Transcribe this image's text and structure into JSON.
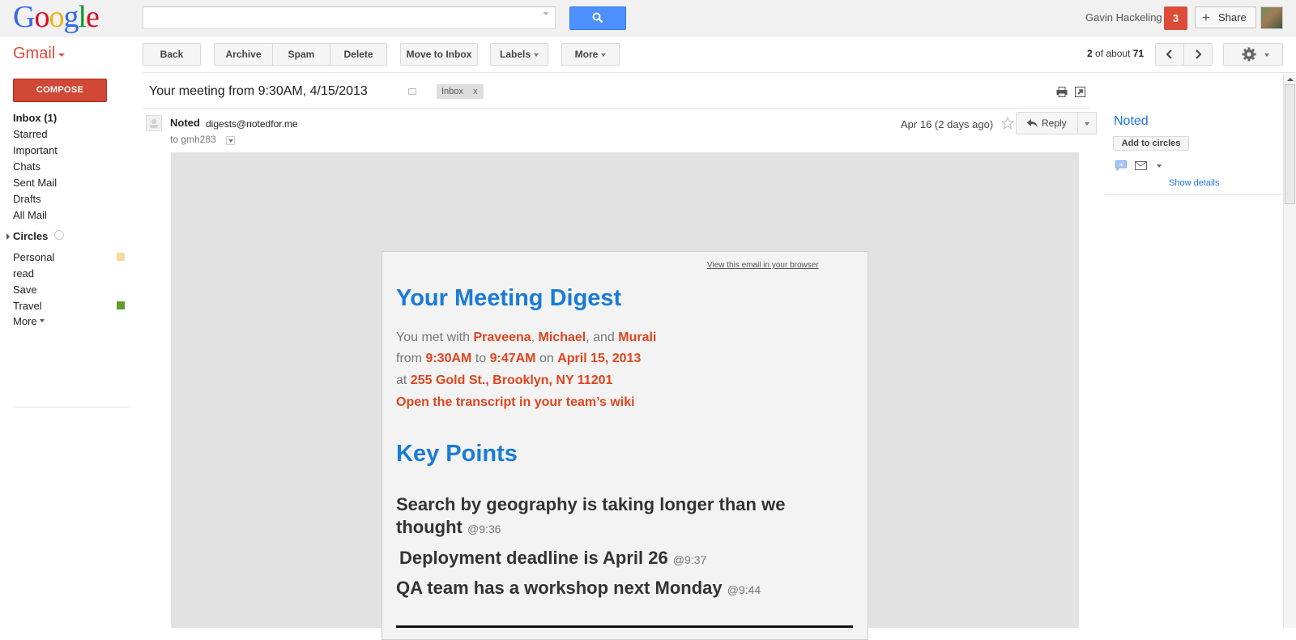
{
  "header": {
    "logo_letters": [
      "G",
      "o",
      "o",
      "g",
      "l",
      "e"
    ],
    "search": {
      "value": "",
      "placeholder": ""
    },
    "user_name": "Gavin Hackeling",
    "notification_count": "3",
    "share_label": "Share"
  },
  "toolbar": {
    "app_label": "Gmail",
    "back": "Back",
    "archive": "Archive",
    "spam": "Spam",
    "delete": "Delete",
    "move_to_inbox": "Move to Inbox",
    "labels": "Labels",
    "more": "More",
    "pager": {
      "current": "2",
      "of_about": "of about",
      "total": "71"
    }
  },
  "sidebar": {
    "compose": "COMPOSE",
    "items": [
      {
        "label": "Inbox (1)",
        "bold": true
      },
      {
        "label": "Starred"
      },
      {
        "label": "Important"
      },
      {
        "label": "Chats"
      },
      {
        "label": "Sent Mail"
      },
      {
        "label": "Drafts"
      },
      {
        "label": "All Mail"
      }
    ],
    "circles_label": "Circles",
    "labels": [
      {
        "label": "Personal",
        "color": "#fad8a0"
      },
      {
        "label": "read"
      },
      {
        "label": "Save"
      },
      {
        "label": "Travel",
        "color": "#5f9e2f"
      }
    ],
    "more": "More"
  },
  "message": {
    "subject": "Your meeting from 9:30AM, 4/15/2013",
    "label_chip": "Inbox",
    "label_chip_close": "x",
    "sender_name": "Noted",
    "sender_email": "digests@notedfor.me",
    "to": "to gmh283",
    "date": "Apr 16 (2 days ago)",
    "reply": "Reply"
  },
  "email_body": {
    "view_in_browser": "View this email in your browser",
    "title": "Your Meeting Digest",
    "met_prefix": "You met with ",
    "person1": "Praveena",
    "sep1": ", ",
    "person2": "Michael",
    "sep2": ", and ",
    "person3": "Murali",
    "from_prefix": "from ",
    "start_time": "9:30AM",
    "to_word": " to ",
    "end_time": "9:47AM",
    "on_word": " on ",
    "date": "April 15, 2013",
    "at_prefix": "at ",
    "location": "255 Gold St., Brooklyn, NY 11201",
    "transcript_link": "Open the transcript in your team’s wiki",
    "key_points_title": "Key Points",
    "key_points": [
      {
        "text": "Search by geography is taking longer than we thought",
        "time": "@9:36"
      },
      {
        "text": "Deployment deadline is April 26",
        "time": "@9:37"
      },
      {
        "text": "QA team has a workshop next Monday",
        "time": "@9:44"
      }
    ]
  },
  "side_panel": {
    "name": "Noted",
    "add_to_circles": "Add to circles",
    "show_details": "Show details"
  },
  "colors": {
    "brand_red": "#dd4b39",
    "search_blue": "#4d90fe",
    "digest_blue": "#1a7bd6",
    "highlight_orange": "#e0441d"
  }
}
